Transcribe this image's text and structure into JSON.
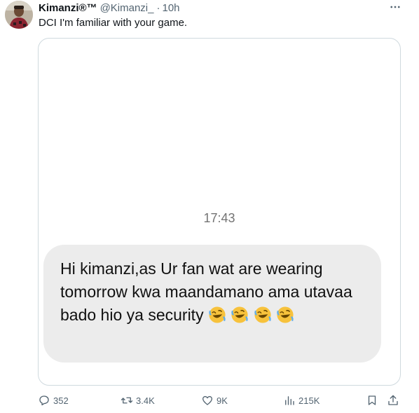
{
  "tweet": {
    "display_name": "Kimanzi®™",
    "handle": "@Kimanzi_",
    "separator": "·",
    "time": "10h",
    "text": "DCI I'm familiar with your game.",
    "avatar_icon": "user-avatar"
  },
  "screenshot": {
    "timestamp": "17:43",
    "message": "Hi kimanzi,as Ur fan wat are wearing tomorrow kwa maandamano ama utavaa bado hio ya security",
    "emoji_icon": "rolling-on-floor-laughing-emoji",
    "emoji_count": 4,
    "bubble_color": "#ececec"
  },
  "actions": {
    "replies": "352",
    "retweets": "3.4K",
    "likes": "9K",
    "views": "215K"
  },
  "colors": {
    "text": "#0f1419",
    "secondary": "#536471",
    "border": "#cfd9de"
  }
}
